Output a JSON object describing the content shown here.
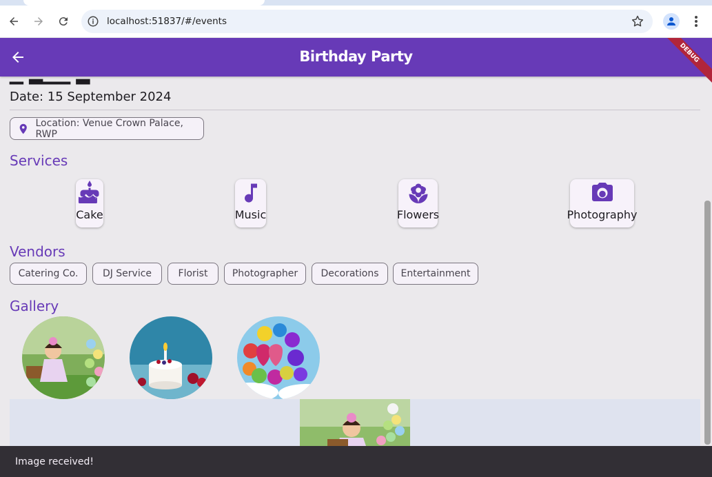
{
  "browser": {
    "url": "localhost:51837/#/events"
  },
  "appbar": {
    "title": "Birthday Party",
    "debug_label": "DEBUG"
  },
  "event": {
    "date": "Date: 15 September 2024",
    "location": "Location: Venue Crown Palace, RWP"
  },
  "services": {
    "title": "Services",
    "items": [
      {
        "label": "Cake",
        "icon": "cake-icon"
      },
      {
        "label": "Music",
        "icon": "music-note-icon"
      },
      {
        "label": "Flowers",
        "icon": "flower-icon"
      },
      {
        "label": "Photography",
        "icon": "camera-icon"
      }
    ]
  },
  "vendors": {
    "title": "Vendors",
    "items": [
      "Catering Co.",
      "DJ Service",
      "Florist",
      "Photographer",
      "Decorations",
      "Entertainment"
    ]
  },
  "gallery": {
    "title": "Gallery"
  },
  "snackbar": {
    "message": "Image received!"
  },
  "colors": {
    "primary": "#673ab7",
    "debug_banner": "#b1253a",
    "snackbar": "#322f35"
  }
}
